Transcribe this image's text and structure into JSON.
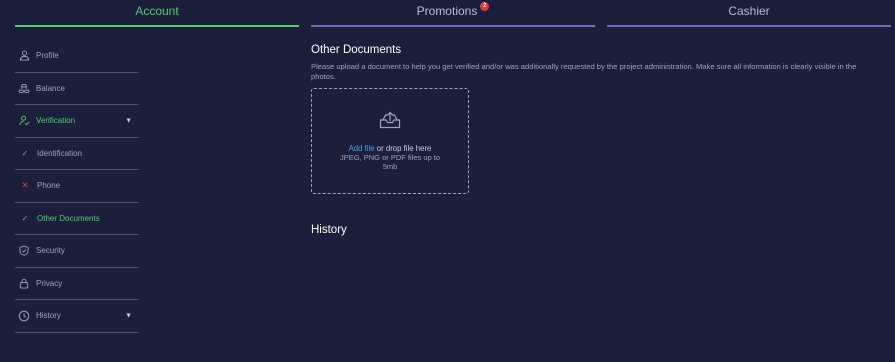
{
  "tabs": [
    {
      "label": "Account",
      "active": true
    },
    {
      "label": "Promotions",
      "badge": "2"
    },
    {
      "label": "Cashier"
    }
  ],
  "sidebar": {
    "items": [
      {
        "label": "Profile",
        "icon": "user-icon"
      },
      {
        "label": "Balance",
        "icon": "coins-icon"
      },
      {
        "label": "Verification",
        "icon": "verification-icon",
        "expanded": true
      },
      {
        "label": "Identification",
        "icon": "check-icon",
        "status": "verified"
      },
      {
        "label": "Phone",
        "icon": "cross-icon",
        "status": "not-verified"
      },
      {
        "label": "Other Documents",
        "icon": "check-icon",
        "status": "verified",
        "selected": true
      },
      {
        "label": "Security",
        "icon": "shield-icon"
      },
      {
        "label": "Privacy",
        "icon": "lock-icon"
      },
      {
        "label": "History",
        "icon": "history-icon",
        "expandable": true
      }
    ]
  },
  "main": {
    "title": "Other Documents",
    "description": "Please upload a document to help you get verified and/or was additionally requested by the project administration. Make sure all information is clearly visible in the photos.",
    "upload": {
      "link_text": "Add file",
      "drop_text": " or drop file here",
      "hint": "JPEG, PNG or PDF files up to 5mb"
    },
    "history_title": "History"
  },
  "colors": {
    "background": "#1c1f3b",
    "accent": "#4fcf6a",
    "link": "#4aa3e8",
    "badge": "#e53737",
    "tab_underline": "#6b6fb5"
  }
}
